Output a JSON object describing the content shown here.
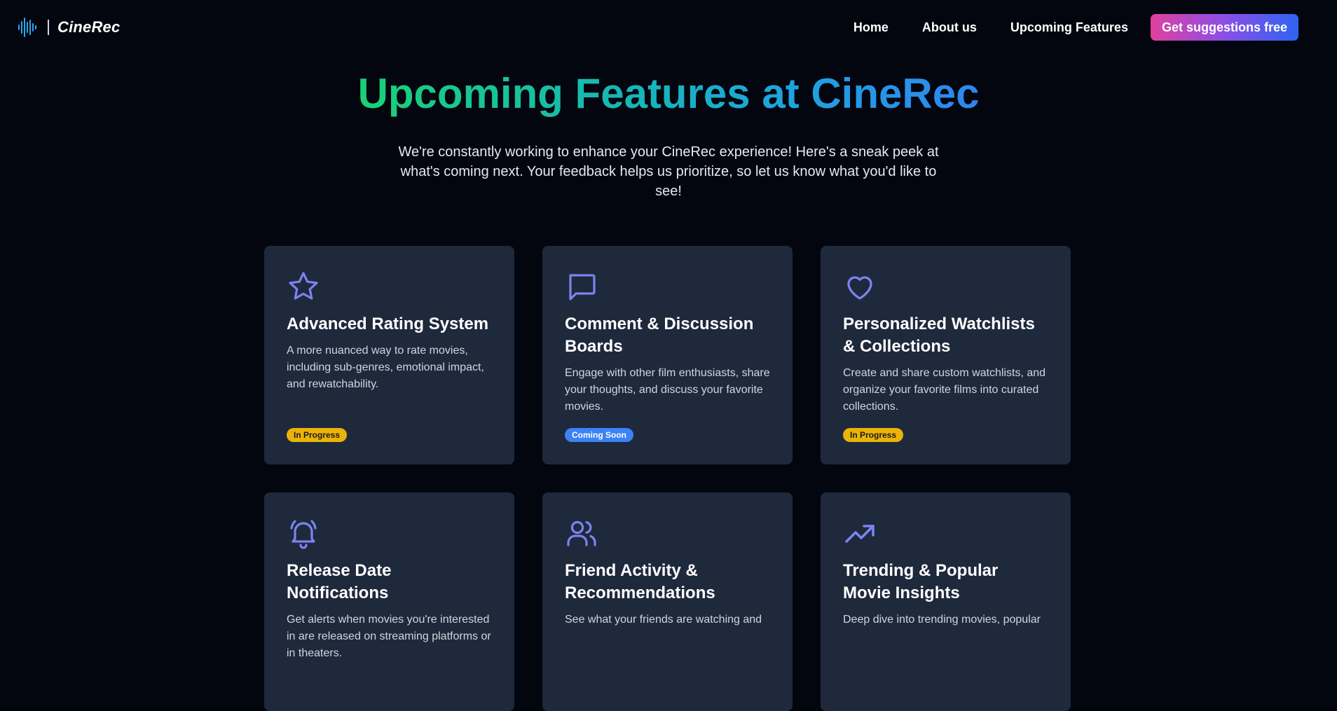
{
  "brand": {
    "name": "CineRec",
    "logo_icon": "soundwave-icon",
    "logo_color": "#2aa8f0"
  },
  "nav": {
    "links": [
      {
        "label": "Home"
      },
      {
        "label": "About us"
      },
      {
        "label": "Upcoming Features"
      }
    ],
    "cta_label": "Get suggestions free"
  },
  "hero": {
    "title": "Upcoming Features at CineRec",
    "subtitle": "We're constantly working to enhance your CineRec experience! Here's a sneak peek at what's coming next. Your feedback helps us prioritize, so let us know what you'd like to see!"
  },
  "theme": {
    "background": "#03060f",
    "card_background": "#1e293b",
    "icon_color": "#7c83f2",
    "badge_in_progress": "#eab308",
    "badge_coming_soon": "#3b82f6"
  },
  "features": [
    {
      "icon": "star-icon",
      "title": "Advanced Rating System",
      "description": "A more nuanced way to rate movies, including sub-genres, emotional impact, and rewatchability.",
      "status": "In Progress"
    },
    {
      "icon": "chat-bubble-icon",
      "title": "Comment & Discussion Boards",
      "description": "Engage with other film enthusiasts, share your thoughts, and discuss your favorite movies.",
      "status": "Coming Soon"
    },
    {
      "icon": "heart-icon",
      "title": "Personalized Watchlists & Collections",
      "description": "Create and share custom watchlists, and organize your favorite films into curated collections.",
      "status": "In Progress"
    },
    {
      "icon": "bell-ringing-icon",
      "title": "Release Date Notifications",
      "description": "Get alerts when movies you're interested in are released on streaming platforms or in theaters."
    },
    {
      "icon": "users-icon",
      "title": "Friend Activity & Recommendations",
      "description": "See what your friends are watching and"
    },
    {
      "icon": "trending-up-icon",
      "title": "Trending & Popular Movie Insights",
      "description": "Deep dive into trending movies, popular"
    }
  ]
}
